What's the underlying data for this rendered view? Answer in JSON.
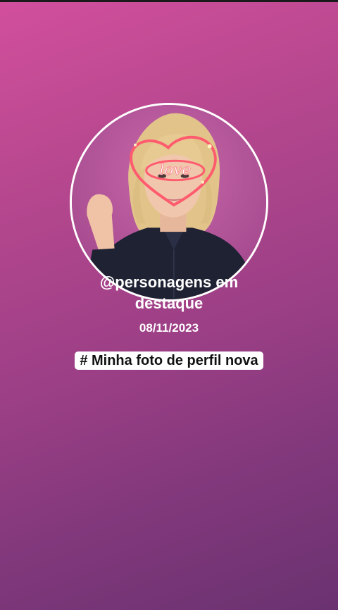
{
  "profile": {
    "handle": "@personagens em destaque",
    "date": "08/11/2023",
    "caption": "# Minha foto de perfil nova",
    "photo_sticker_text": "love"
  },
  "colors": {
    "gradient_top": "#d24f9d",
    "gradient_bottom": "#6a3270",
    "ring": "#ffffff",
    "sticker": "#ff5b6e"
  }
}
